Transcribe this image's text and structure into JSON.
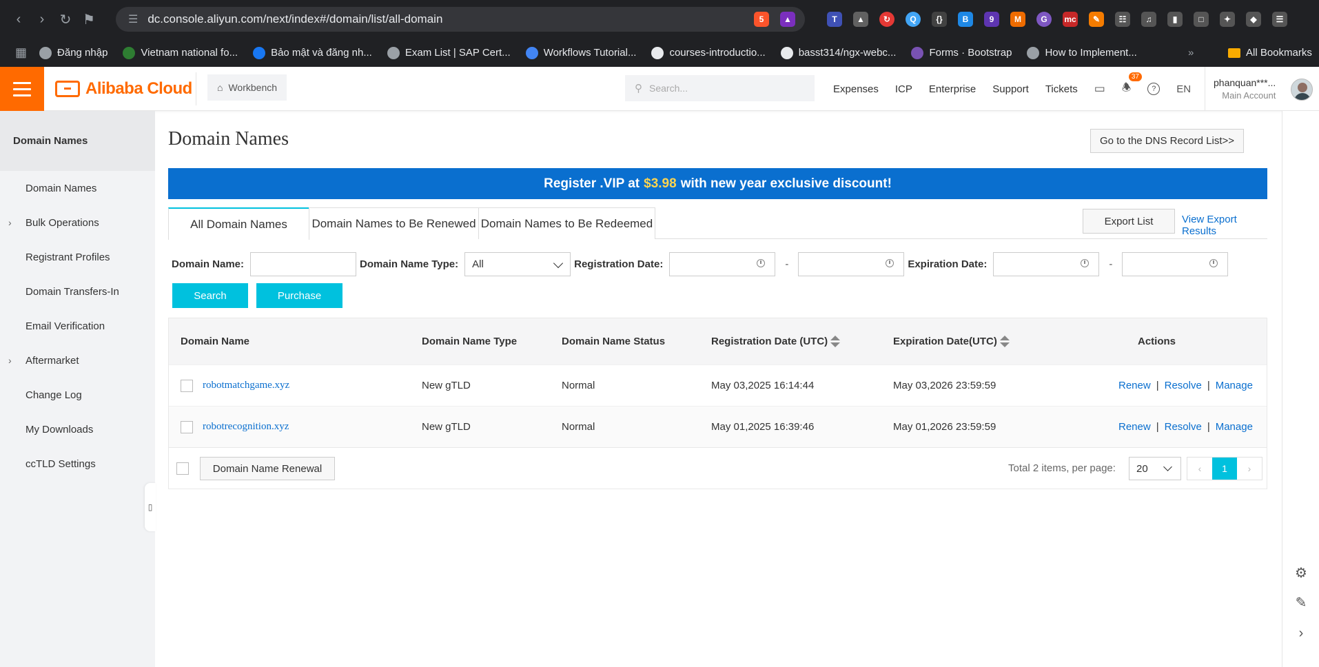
{
  "browser": {
    "url": "dc.console.aliyun.com/next/index#/domain/list/all-domain",
    "extensions_badge": "9",
    "brave_badge": "5",
    "bookmarks": [
      {
        "label": "Đăng nhập",
        "icon": "globe-icon"
      },
      {
        "label": "Vietnam national fo...",
        "icon": "bars-icon"
      },
      {
        "label": "Bảo mật và đăng nh...",
        "icon": "facebook-icon"
      },
      {
        "label": "Exam List | SAP Cert...",
        "icon": "globe-icon"
      },
      {
        "label": "Workflows Tutorial...",
        "icon": "cloud-icon"
      },
      {
        "label": "courses-introductio...",
        "icon": "github-icon"
      },
      {
        "label": "basst314/ngx-webc...",
        "icon": "github-icon"
      },
      {
        "label": "Forms · Bootstrap",
        "icon": "bootstrap-icon"
      },
      {
        "label": "How to Implement...",
        "icon": "globe-icon"
      }
    ],
    "all_bookmarks": "All Bookmarks"
  },
  "topbar": {
    "brand": "Alibaba Cloud",
    "workbench": "Workbench",
    "search_placeholder": "Search...",
    "nav": [
      "Expenses",
      "ICP",
      "Enterprise",
      "Support",
      "Tickets"
    ],
    "notifications": "37",
    "language": "EN",
    "account_name": "phanquan***...",
    "account_role": "Main Account"
  },
  "sidebar": {
    "title": "Domain Names",
    "items": [
      {
        "label": "Domain Names",
        "expandable": false
      },
      {
        "label": "Bulk Operations",
        "expandable": true
      },
      {
        "label": "Registrant Profiles",
        "expandable": false
      },
      {
        "label": "Domain Transfers-In",
        "expandable": false
      },
      {
        "label": "Email Verification",
        "expandable": false
      },
      {
        "label": "Aftermarket",
        "expandable": true
      },
      {
        "label": "Change Log",
        "expandable": false
      },
      {
        "label": "My Downloads",
        "expandable": false
      },
      {
        "label": "ccTLD Settings",
        "expandable": false
      }
    ]
  },
  "main": {
    "title": "Domain Names",
    "dns_button": "Go to the DNS Record List>>",
    "banner": {
      "before": "Register .VIP at",
      "price": "$3.98",
      "after": "with new year exclusive discount!"
    },
    "tabs": [
      "All Domain Names",
      "Domain Names to Be Renewed",
      "Domain Names to Be Redeemed"
    ],
    "export_button": "Export List",
    "view_export": "View Export Results",
    "filters": {
      "domain_name_label": "Domain Name:",
      "domain_name_value": "",
      "type_label": "Domain Name Type:",
      "type_value": "All",
      "reg_label": "Registration Date:",
      "exp_label": "Expiration Date:",
      "dash": "-"
    },
    "search_button": "Search",
    "purchase_button": "Purchase",
    "table": {
      "headers": [
        "Domain Name",
        "Domain Name Type",
        "Domain Name Status",
        "Registration Date (UTC)",
        "Expiration Date(UTC)",
        "Actions"
      ],
      "rows": [
        {
          "domain": "robotmatchgame.xyz",
          "type": "New gTLD",
          "status": "Normal",
          "reg": "May 03,2025 16:14:44",
          "exp": "May 03,2026 23:59:59"
        },
        {
          "domain": "robotrecognition.xyz",
          "type": "New gTLD",
          "status": "Normal",
          "reg": "May 01,2025 16:39:46",
          "exp": "May 01,2026 23:59:59"
        }
      ],
      "actions": [
        "Renew",
        "Resolve",
        "Manage"
      ]
    },
    "renew_button": "Domain Name Renewal",
    "total": "Total 2 items,  per page:",
    "per_page": "20",
    "current_page": "1"
  }
}
